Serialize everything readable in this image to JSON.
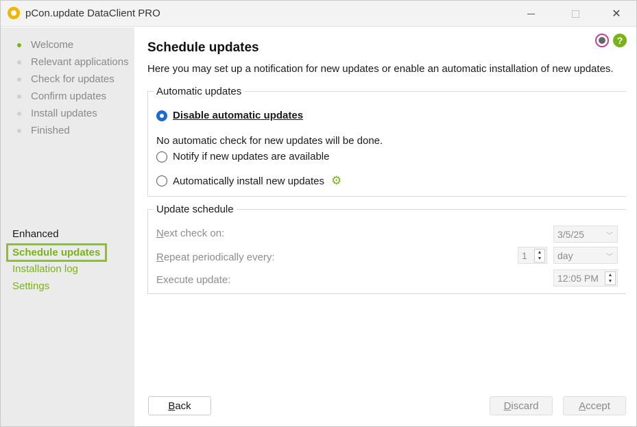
{
  "window": {
    "title": "pCon.update DataClient PRO"
  },
  "steps": [
    {
      "label": "Welcome",
      "active": true
    },
    {
      "label": "Relevant applications"
    },
    {
      "label": "Check for updates"
    },
    {
      "label": "Confirm updates"
    },
    {
      "label": "Install updates"
    },
    {
      "label": "Finished"
    }
  ],
  "enhanced": {
    "heading": "Enhanced",
    "items": [
      "Schedule updates",
      "Installation log",
      "Settings"
    ]
  },
  "main": {
    "title": "Schedule updates",
    "description": "Here you may set up a notification for new updates or enable an automatic installation of new updates.",
    "automatic": {
      "legend": "Automatic updates",
      "options": [
        "Disable automatic updates",
        "Notify if new updates are available",
        "Automatically install new updates"
      ],
      "selected_index": 0,
      "note": "No automatic check for new updates will be done."
    },
    "schedule": {
      "legend": "Update schedule",
      "next_check_label_first": "N",
      "next_check_label_rest": "ext check on:",
      "next_check_value": "3/5/25",
      "repeat_label_first": "R",
      "repeat_label_rest": "epeat periodically every:",
      "repeat_count": "1",
      "repeat_unit": "day",
      "execute_label": "Execute update:",
      "execute_time": "12:05 PM"
    }
  },
  "buttons": {
    "back_first": "B",
    "back_rest": "ack",
    "discard_first": "D",
    "discard_rest": "iscard",
    "accept_first": "A",
    "accept_rest": "ccept"
  },
  "colors": {
    "accent_green": "#7ab317",
    "radio_blue": "#1e6bd0"
  }
}
